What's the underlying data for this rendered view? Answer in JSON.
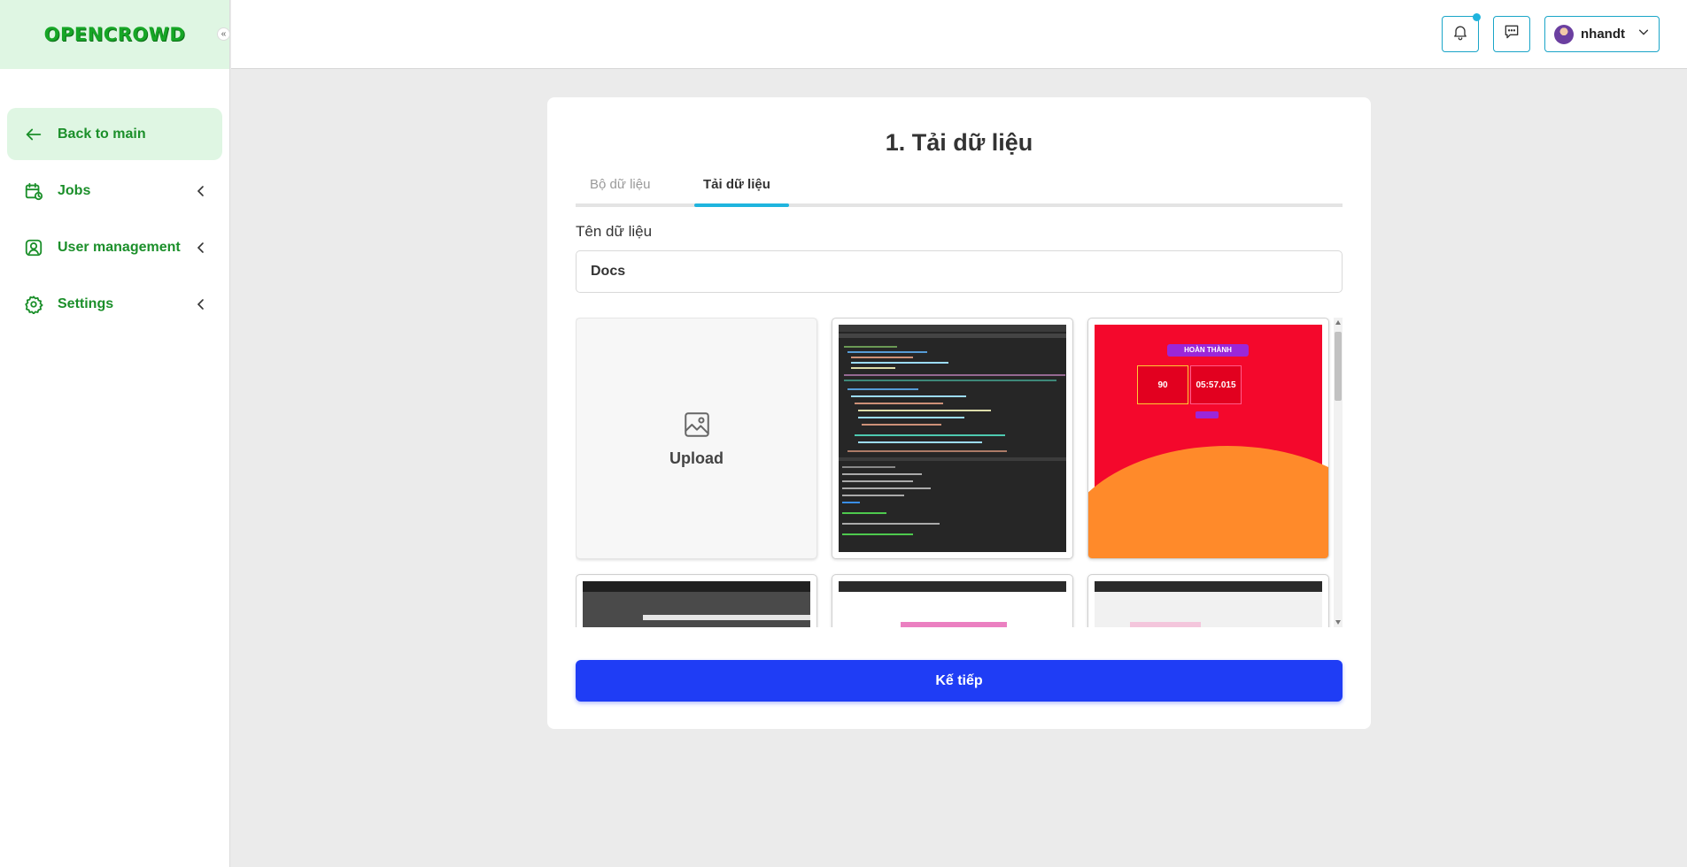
{
  "sidebar": {
    "logo": "OPENCROWD",
    "collapse_icon": "«",
    "items": [
      {
        "label": "Back to main",
        "icon": "arrow-left-icon",
        "active": true
      },
      {
        "label": "Jobs",
        "icon": "calendar-icon"
      },
      {
        "label": "User management",
        "icon": "user-square-icon"
      },
      {
        "label": "Settings",
        "icon": "gear-icon"
      }
    ]
  },
  "header": {
    "username": "nhandt",
    "icons": [
      "bell-icon",
      "message-icon",
      "chevron-down-icon"
    ]
  },
  "main": {
    "title": "1. Tải dữ liệu",
    "tabs": [
      {
        "label": "Bộ dữ liệu",
        "active": false
      },
      {
        "label": "Tải dữ liệu",
        "active": true
      }
    ],
    "field_label": "Tên dữ liệu",
    "field_value": "Docs",
    "upload_label": "Upload",
    "game_thumb": {
      "banner": "HOÀN THÀNH",
      "score": "90",
      "time": "05:57.015"
    },
    "next_button": "Kế tiếp"
  },
  "colors": {
    "brand_green": "#16a626",
    "accent_cyan": "#1fb4de",
    "primary_blue": "#1f3df5"
  }
}
